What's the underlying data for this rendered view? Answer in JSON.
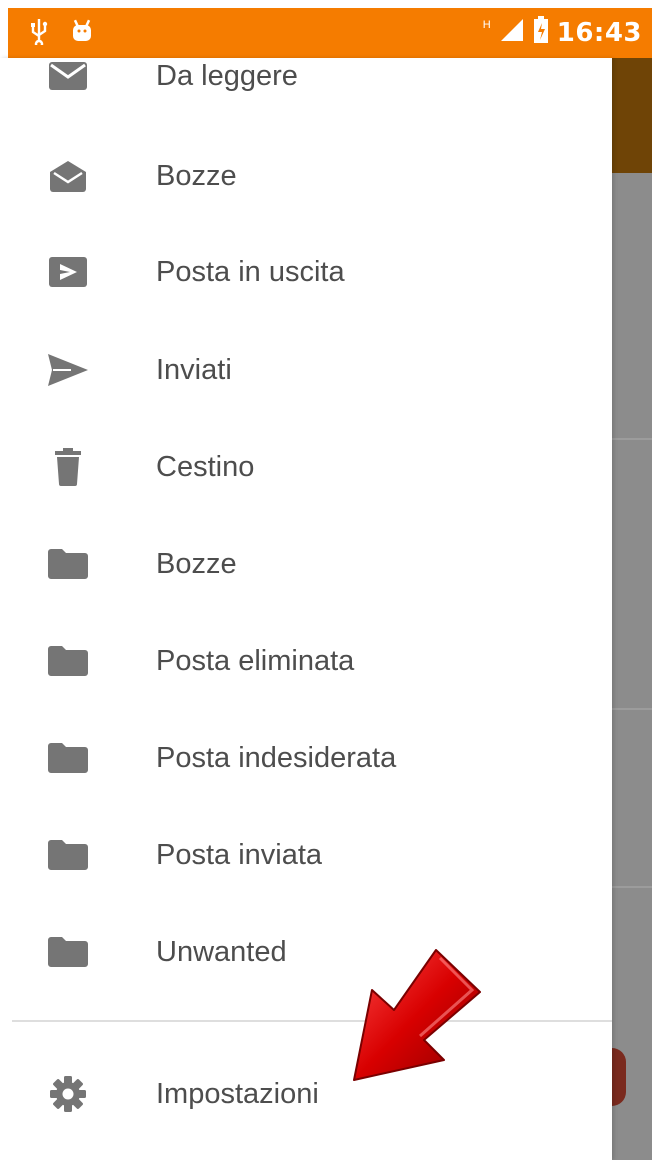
{
  "status_bar": {
    "time": "16:43",
    "network_indicator": "H",
    "icons": [
      "usb-icon",
      "android-icon",
      "signal-icon",
      "battery-icon"
    ],
    "background_color": "#f57c00"
  },
  "drawer": {
    "folders": [
      {
        "label": "Da leggere",
        "icon": "envelope-icon"
      },
      {
        "label": "Bozze",
        "icon": "drafts-icon"
      },
      {
        "label": "Posta in uscita",
        "icon": "outbox-icon"
      },
      {
        "label": "Inviati",
        "icon": "send-icon"
      },
      {
        "label": "Cestino",
        "icon": "trash-icon"
      },
      {
        "label": "Bozze",
        "icon": "folder-icon"
      },
      {
        "label": "Posta eliminata",
        "icon": "folder-icon"
      },
      {
        "label": "Posta indesiderata",
        "icon": "folder-icon"
      },
      {
        "label": "Posta inviata",
        "icon": "folder-icon"
      },
      {
        "label": "Unwanted",
        "icon": "folder-icon"
      }
    ],
    "settings_label": "Impostazioni",
    "settings_icon": "gear-icon",
    "icon_color": "#757575",
    "text_color": "#4d4d4d"
  },
  "annotation": {
    "icon": "red-arrow-icon",
    "color": "#cc0000"
  }
}
